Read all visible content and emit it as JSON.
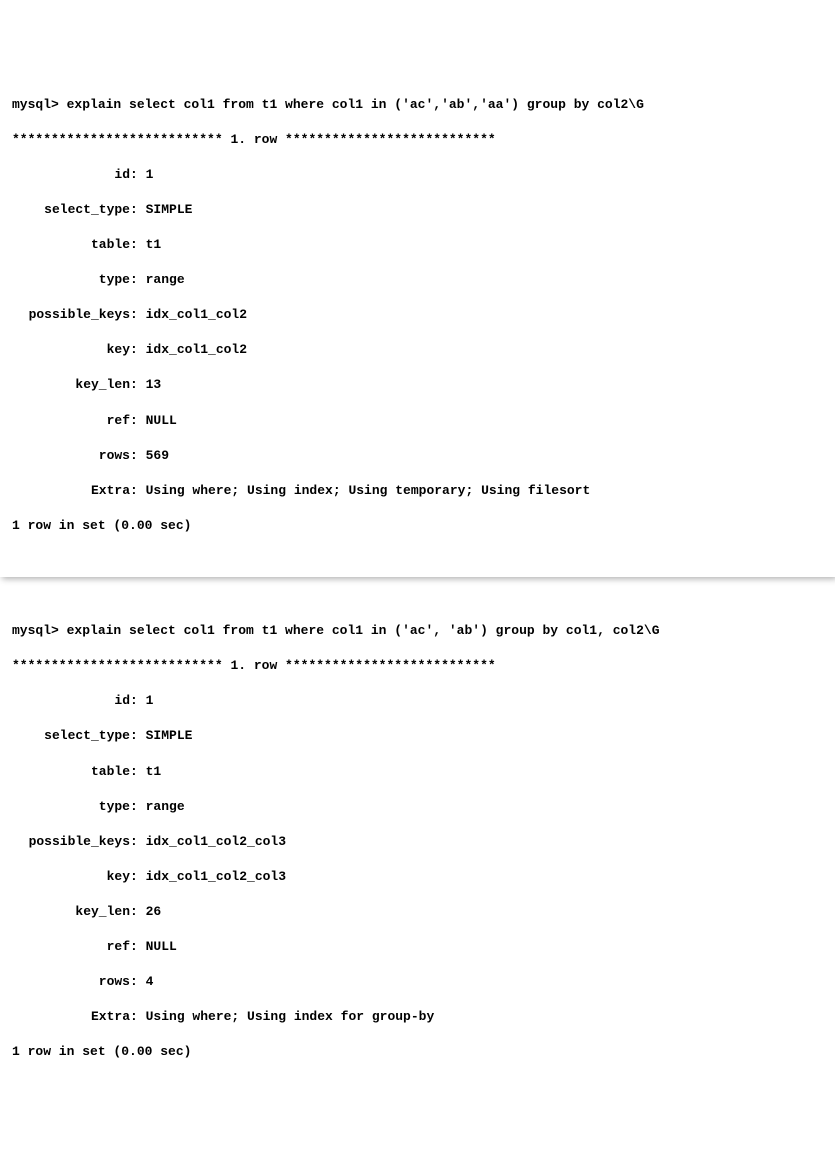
{
  "prompt": "mysql> ",
  "row_separator_left": "*************************** ",
  "row_separator_title": "1. row",
  "row_separator_right": " ***************************",
  "colon": ": ",
  "queries": [
    {
      "sql": "explain select col1 from t1 where col1 in ('ac','ab','aa') group by col2\\G",
      "fields": [
        {
          "label": "id",
          "value": "1"
        },
        {
          "label": "select_type",
          "value": "SIMPLE"
        },
        {
          "label": "table",
          "value": "t1"
        },
        {
          "label": "type",
          "value": "range"
        },
        {
          "label": "possible_keys",
          "value": "idx_col1_col2"
        },
        {
          "label": "key",
          "value": "idx_col1_col2"
        },
        {
          "label": "key_len",
          "value": "13"
        },
        {
          "label": "ref",
          "value": "NULL"
        },
        {
          "label": "rows",
          "value": "569"
        },
        {
          "label": "Extra",
          "value": "Using where; Using index; Using temporary; Using filesort"
        }
      ],
      "footer": "1 row in set (0.00 sec)"
    },
    {
      "sql": "explain select col1 from t1 where col1 in ('ac', 'ab') group by col1, col2\\G",
      "fields": [
        {
          "label": "id",
          "value": "1"
        },
        {
          "label": "select_type",
          "value": "SIMPLE"
        },
        {
          "label": "table",
          "value": "t1"
        },
        {
          "label": "type",
          "value": "range"
        },
        {
          "label": "possible_keys",
          "value": "idx_col1_col2_col3"
        },
        {
          "label": "key",
          "value": "idx_col1_col2_col3"
        },
        {
          "label": "key_len",
          "value": "26"
        },
        {
          "label": "ref",
          "value": "NULL"
        },
        {
          "label": "rows",
          "value": "4"
        },
        {
          "label": "Extra",
          "value": "Using where; Using index for group-by"
        }
      ],
      "footer": "1 row in set (0.00 sec)"
    }
  ]
}
